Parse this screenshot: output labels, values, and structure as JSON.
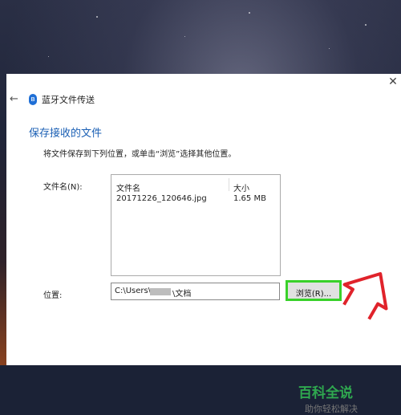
{
  "window": {
    "title": "蓝牙文件传送",
    "close_glyph": "✕",
    "back_glyph": "←",
    "bluetooth_glyph": "ʙ"
  },
  "main": {
    "heading": "保存接收的文件",
    "instruction": "将文件保存到下列位置，或单击“浏览”选择其他位置。",
    "filename_label": "文件名(N):",
    "file_list": {
      "columns": [
        "文件名",
        "大小"
      ],
      "rows": [
        {
          "name": "20171226_120646.jpg",
          "size": "1.65 MB"
        }
      ]
    },
    "location_label": "位置:",
    "location_value_prefix": "C:\\Users\\",
    "location_value_suffix": "\\文档",
    "browse_label": "浏览(R)..."
  },
  "watermark": {
    "main": "百科全说",
    "sub": "助你轻松解决"
  },
  "colors": {
    "heading": "#1a5fb4",
    "highlight_box": "#39d12a",
    "arrow": "#e0232b",
    "watermark": "#2fa84f"
  }
}
